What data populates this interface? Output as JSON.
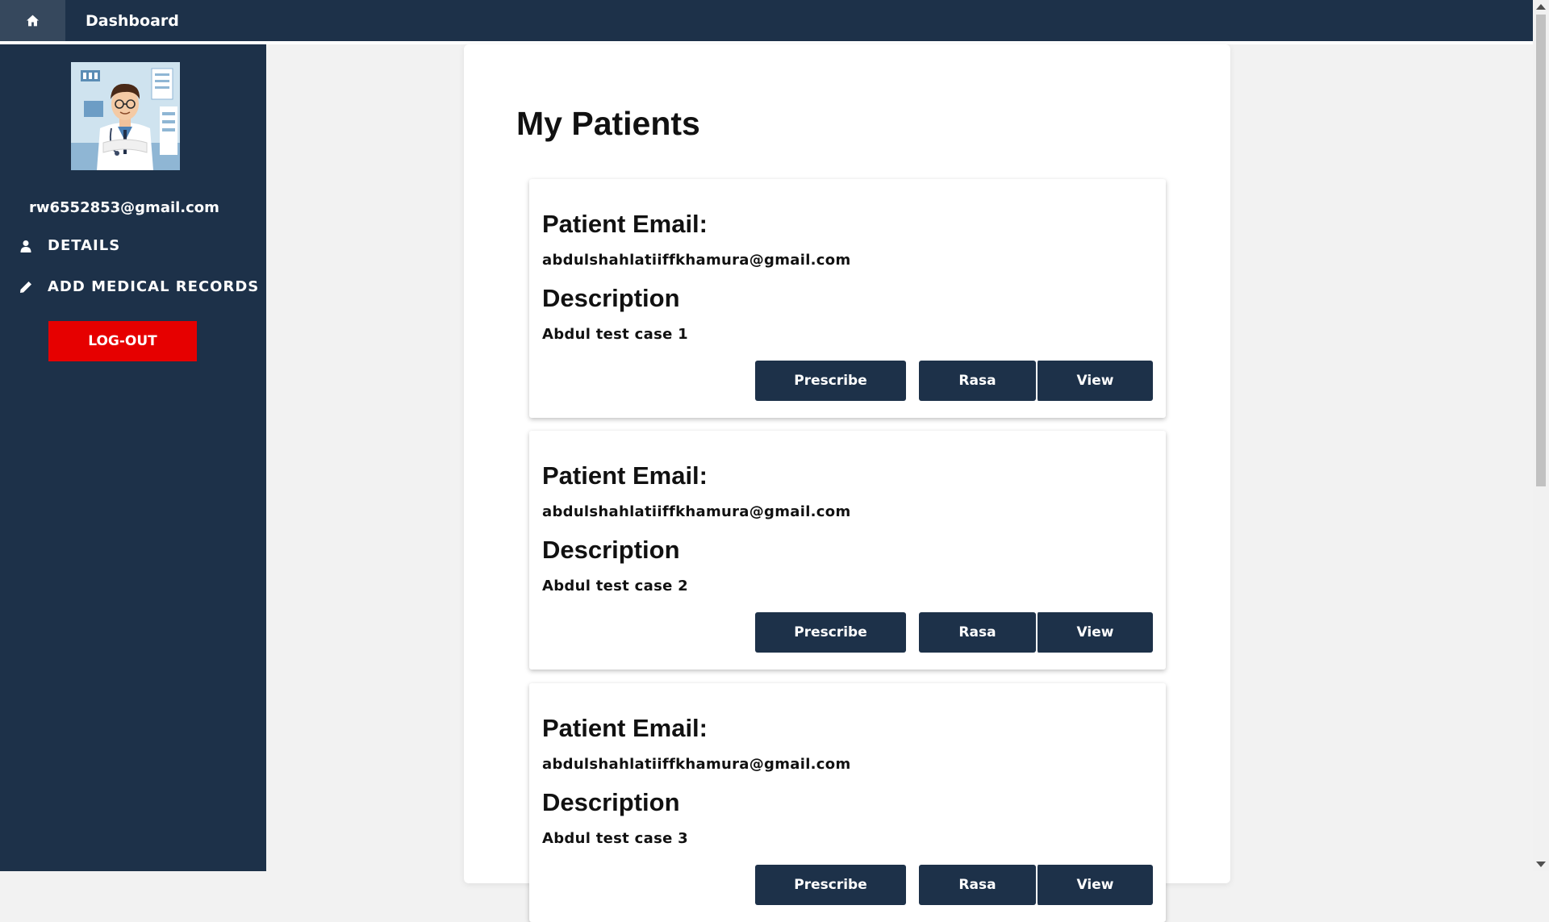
{
  "topbar": {
    "home_icon": "home-icon",
    "title": "Dashboard"
  },
  "sidebar": {
    "avatar_icon": "doctor-avatar",
    "email": "rw6552853@gmail.com",
    "items": [
      {
        "label": "DETAILS",
        "icon": "user-icon"
      },
      {
        "label": "ADD MEDICAL RECORDS",
        "icon": "pencil-icon"
      }
    ],
    "logout_label": "LOG-OUT"
  },
  "main": {
    "title": "My Patients",
    "email_label": "Patient Email:",
    "description_label": "Description",
    "patients": [
      {
        "email": "abdulshahlatiiffkhamura@gmail.com",
        "description": "Abdul test case 1"
      },
      {
        "email": "abdulshahlatiiffkhamura@gmail.com",
        "description": "Abdul test case 2"
      },
      {
        "email": "abdulshahlatiiffkhamura@gmail.com",
        "description": "Abdul test case 3"
      }
    ],
    "buttons": {
      "prescribe": "Prescribe",
      "rasa": "Rasa",
      "view": "View"
    }
  },
  "colors": {
    "navy": "#1d3149",
    "logout_red": "#e60000",
    "home_tab": "#36485d",
    "page_bg": "#f2f2f2"
  }
}
